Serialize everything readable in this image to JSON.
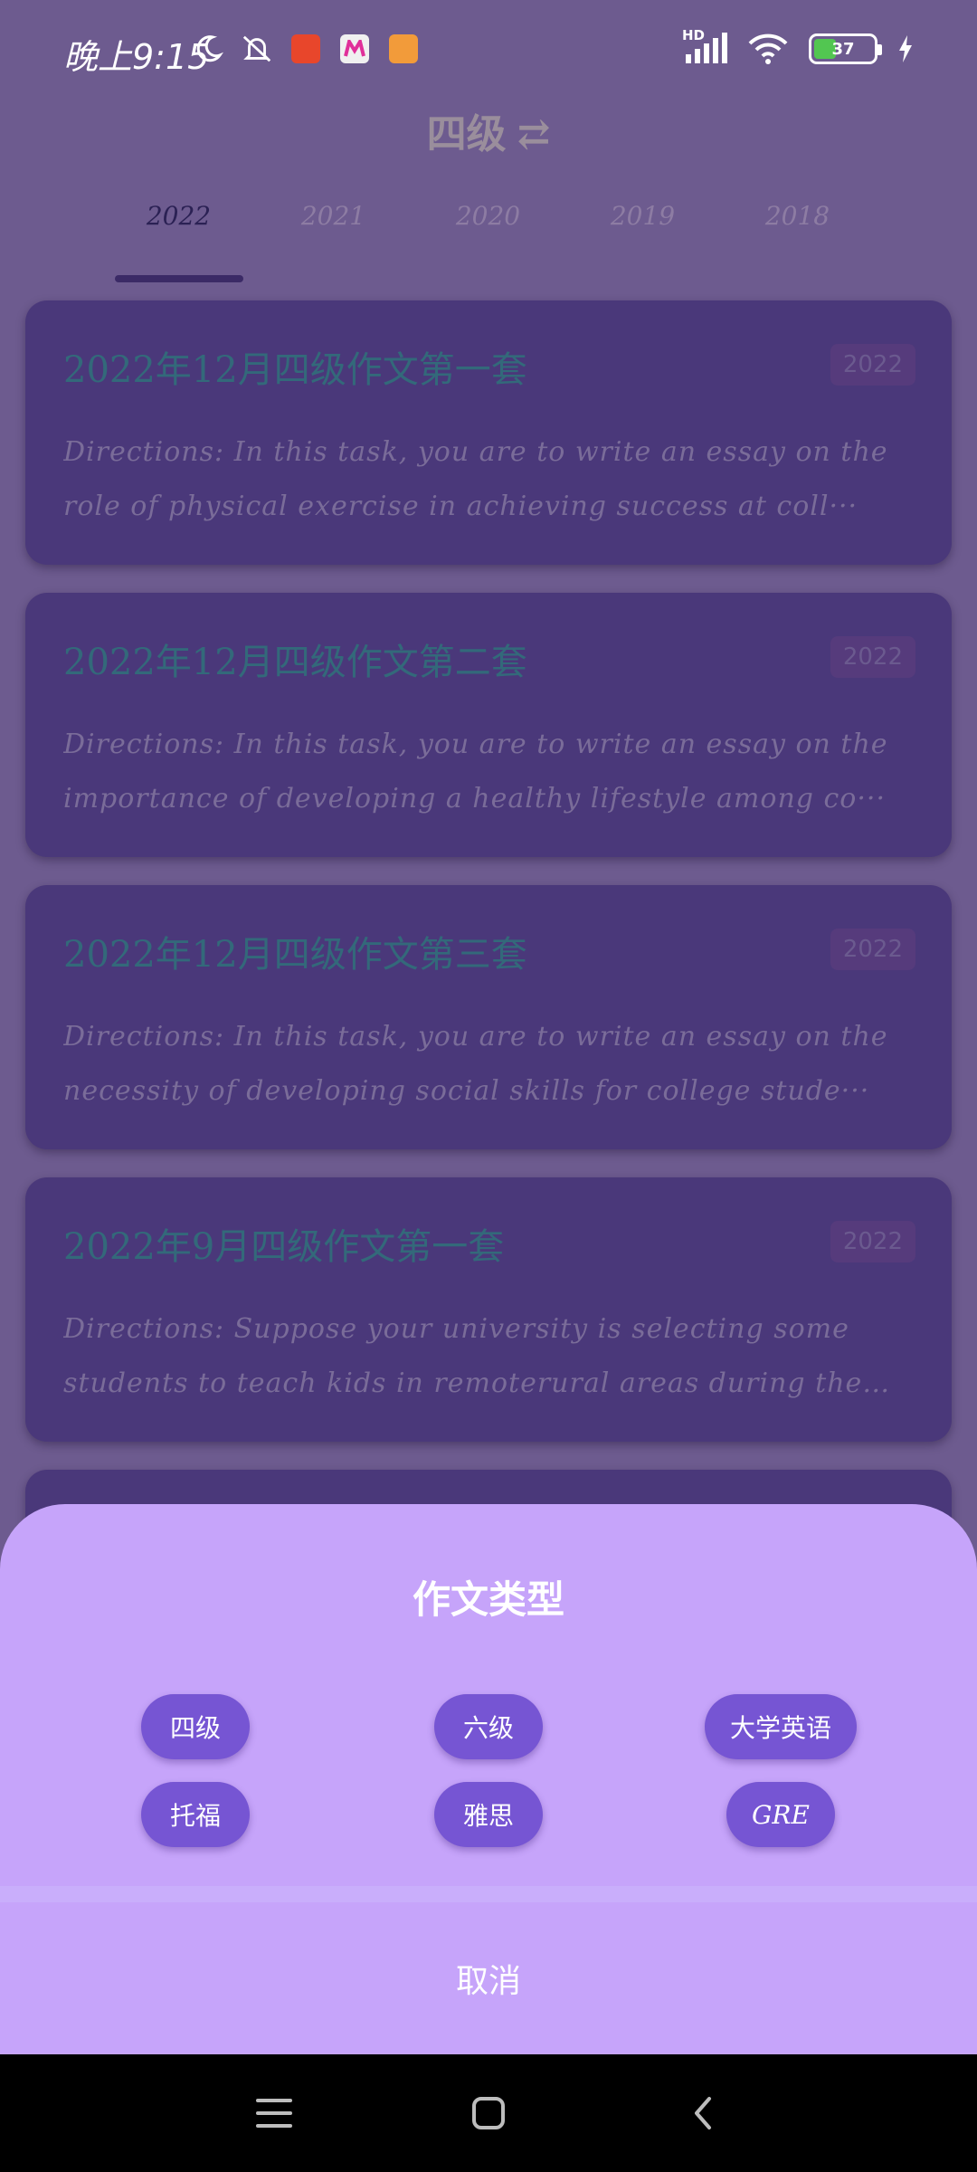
{
  "status_bar": {
    "time": "晚上9:15",
    "battery_level": "37",
    "battery_fraction": 0.37,
    "network_label": "HD",
    "icons": [
      "moon-icon",
      "silent-icon",
      "taobao-app-icon",
      "meituan-app-icon",
      "app-icon",
      "signal-icon",
      "wifi-icon",
      "battery-icon",
      "charging-icon"
    ]
  },
  "header": {
    "title": "四级",
    "swap_icon": "⇄"
  },
  "tabs": [
    {
      "label": "2022",
      "active": true
    },
    {
      "label": "2021",
      "active": false
    },
    {
      "label": "2020",
      "active": false
    },
    {
      "label": "2019",
      "active": false
    },
    {
      "label": "2018",
      "active": false
    }
  ],
  "essays": [
    {
      "title": "2022年12月四级作文第一套",
      "badge": "2022",
      "description": " Directions: In this task, you are to write an essay on the role of physical exercise in achieving success at coll···"
    },
    {
      "title": "2022年12月四级作文第二套",
      "badge": "2022",
      "description": "Directions: In this task, you are to write an essay on the importance of developing a healthy lifestyle among co···"
    },
    {
      "title": "2022年12月四级作文第三套",
      "badge": "2022",
      "description": "Directions: In this task, you are to write an essay on the necessity of developing social skills for college stude···"
    },
    {
      "title": "2022年9月四级作文第一套",
      "badge": "2022",
      "description": "Directions: Suppose your university is selecting some students to teach kids in remoterural areas during the co···"
    }
  ],
  "sheet": {
    "title": "作文类型",
    "options": [
      "四级",
      "六级",
      "大学英语",
      "托福",
      "雅思",
      "GRE"
    ],
    "cancel_label": "取消"
  },
  "colors": {
    "sheet_background": "#c6a4fa",
    "option_button": "#7655d3",
    "card_background": "#4a387a",
    "card_title": "#33697a"
  }
}
